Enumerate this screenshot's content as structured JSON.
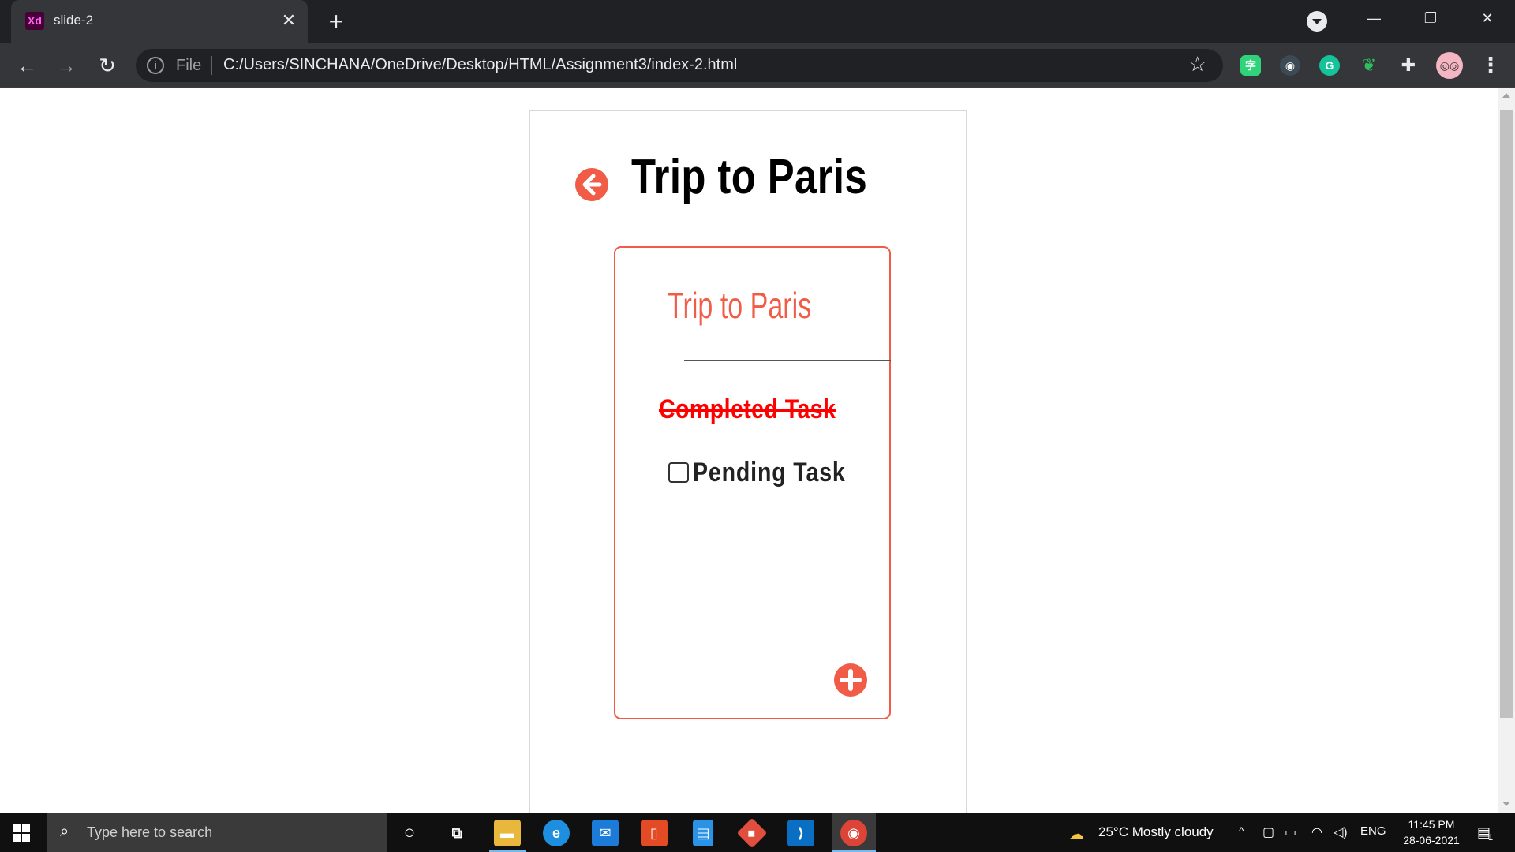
{
  "browser": {
    "tab_icon_text": "Xd",
    "tab_title": "slide-2",
    "tab_close": "✕",
    "new_tab": "+",
    "scheme_label": "File",
    "url": "C:/Users/SINCHANA/OneDrive/Desktop/HTML/Assignment3/index-2.html",
    "extensions": [
      {
        "name": "translate-extension",
        "color": "#2fd37a"
      },
      {
        "name": "screen-extension",
        "color": "#3c4a56"
      },
      {
        "name": "grammarly-extension",
        "color": "#15c39a",
        "label": "G"
      },
      {
        "name": "evernote-extension",
        "color": "#2dbe60"
      },
      {
        "name": "puzzle-extension",
        "color": "#35363a"
      }
    ]
  },
  "page": {
    "title": "Trip to Paris",
    "card": {
      "title": "Trip to Paris",
      "completed_task": "Completed Task",
      "pending_task": "Pending Task",
      "pending_checked": false
    },
    "accent_color": "#f15c46"
  },
  "taskbar": {
    "search_placeholder": "Type here to search",
    "weather": "25°C  Mostly cloudy",
    "language": "ENG",
    "time": "11:45 PM",
    "date": "28-06-2021",
    "notification_count": "1"
  }
}
